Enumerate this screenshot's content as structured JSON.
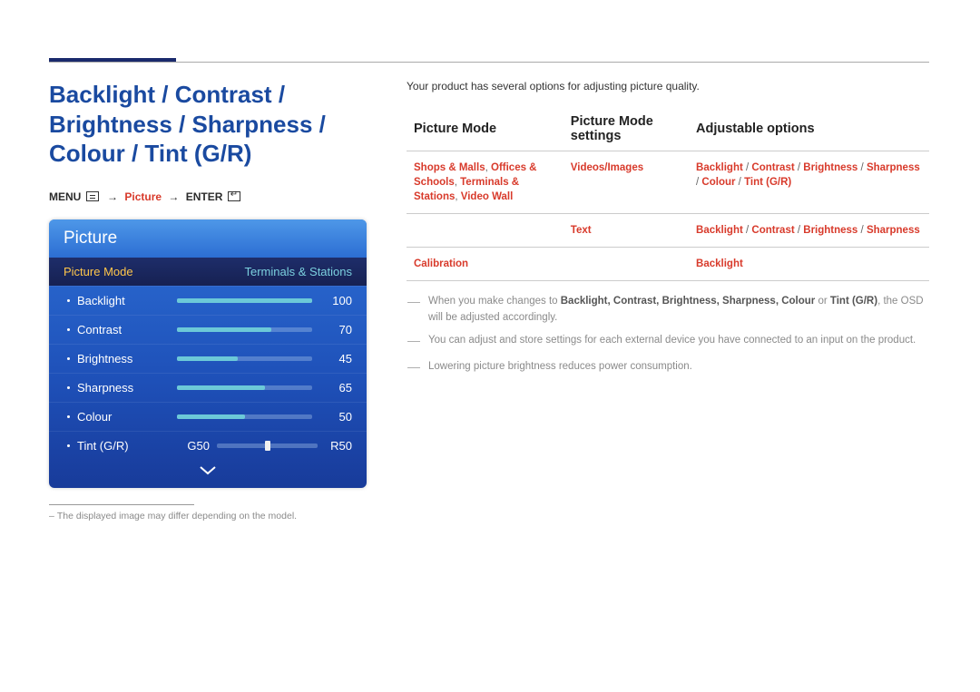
{
  "heading": "Backlight / Contrast / Brightness / Sharpness / Colour / Tint (G/R)",
  "breadcrumb": {
    "menu_label": "MENU",
    "section": "Picture",
    "enter_label": "ENTER",
    "arrow": "→"
  },
  "osd": {
    "title": "Picture",
    "mode_row": {
      "label": "Picture Mode",
      "value": "Terminals & Stations"
    },
    "items": [
      {
        "name": "Backlight",
        "value": "100",
        "pct": 100
      },
      {
        "name": "Contrast",
        "value": "70",
        "pct": 70
      },
      {
        "name": "Brightness",
        "value": "45",
        "pct": 45
      },
      {
        "name": "Sharpness",
        "value": "65",
        "pct": 65
      },
      {
        "name": "Colour",
        "value": "50",
        "pct": 50
      }
    ],
    "tint": {
      "name": "Tint (G/R)",
      "g": "G50",
      "r": "R50"
    }
  },
  "footnote": "The displayed image may differ depending on the model.",
  "right": {
    "intro": "Your product has several options for adjusting picture quality.",
    "columns": {
      "c1": "Picture Mode",
      "c2": "Picture Mode settings",
      "c3": "Adjustable options"
    },
    "rows": [
      {
        "c1": "Shops & Malls, Offices & Schools, Terminals & Stations, Video Wall",
        "c2": "Videos/Images",
        "c3": "Backlight / Contrast / Brightness / Sharpness / Colour / Tint (G/R)"
      },
      {
        "c1": "",
        "c2": "Text",
        "c3": "Backlight / Contrast / Brightness / Sharpness"
      },
      {
        "c1": "Calibration",
        "c2": "",
        "c3": "Backlight"
      }
    ],
    "notes": {
      "n1_prefix": "When you make changes to ",
      "n1_bold": "Backlight, Contrast, Brightness, Sharpness, Colour",
      "n1_mid": " or ",
      "n1_bold2": "Tint (G/R)",
      "n1_suffix": ", the OSD will be adjusted accordingly.",
      "n2": "You can adjust and store settings for each external device you have connected to an input on the product.",
      "n3": "Lowering picture brightness reduces power consumption."
    }
  }
}
